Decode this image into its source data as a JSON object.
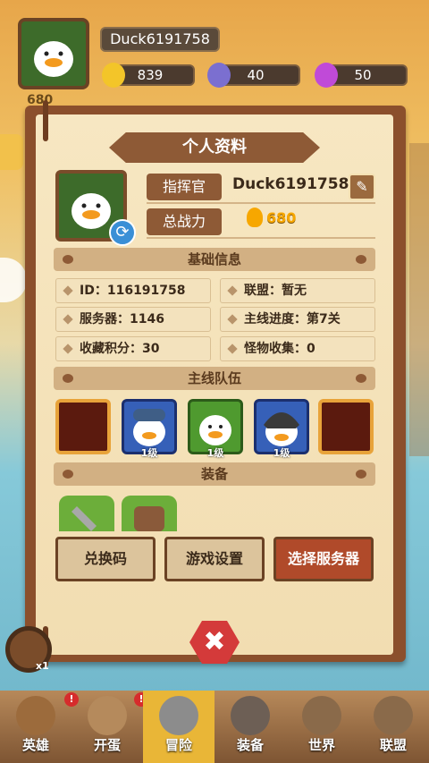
{
  "hud": {
    "player_name": "Duck6191758",
    "gold": "839",
    "gems": "40",
    "crystals": "50",
    "power": "680"
  },
  "panel": {
    "title": "个人资料",
    "commander_label": "指挥官",
    "commander_name": "Duck6191758",
    "power_label": "总战力",
    "power_value": "680",
    "section_basic": "基础信息",
    "id_label": "ID：",
    "id_value": "116191758",
    "alliance_label": "联盟：",
    "alliance_value": "暂无",
    "server_label": "服务器：",
    "server_value": "1146",
    "progress_label": "主线进度：",
    "progress_value": "第7关",
    "collect_label": "收藏积分：",
    "collect_value": "30",
    "monster_label": "怪物收集：",
    "monster_value": "0",
    "section_team": "主线队伍",
    "section_equip": "装备",
    "team_levels": [
      "1级",
      "1级",
      "1级"
    ],
    "btn_redeem": "兑换码",
    "btn_settings": "游戏设置",
    "btn_server": "选择服务器",
    "close_label": "✖",
    "multiplier": "x1"
  },
  "nav": {
    "items": [
      "英雄",
      "开蛋",
      "冒险",
      "装备",
      "世界",
      "联盟"
    ],
    "badge": "!"
  },
  "colors": {
    "panel_brown": "#8b4f2c",
    "paper": "#f7e7c2",
    "power_gold": "#f7a700",
    "close_red": "#d43a3a"
  }
}
